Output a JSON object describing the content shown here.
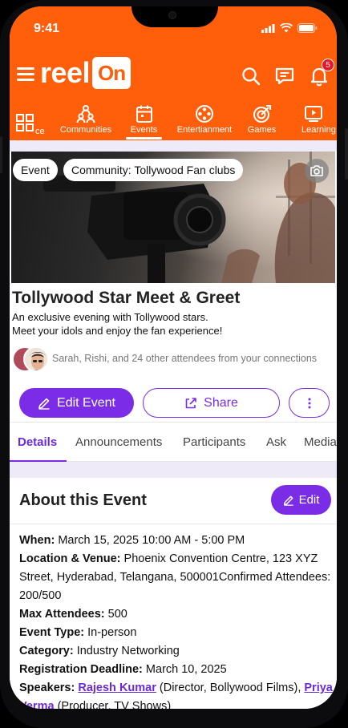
{
  "status_bar": {
    "time": "9:41"
  },
  "header": {
    "logo_text": "reel",
    "logo_box_text": "On",
    "notification_count": "5",
    "colors": {
      "brand": "#ff5f0b",
      "accent": "#7a2ce6"
    }
  },
  "nav": {
    "items": [
      {
        "label": "ce",
        "icon": "grid-icon"
      },
      {
        "label": "Communities",
        "icon": "people-icon"
      },
      {
        "label": "Events",
        "icon": "calendar-icon",
        "active": true
      },
      {
        "label": "Entertianment",
        "icon": "film-reel-icon"
      },
      {
        "label": "Games",
        "icon": "target-icon"
      },
      {
        "label": "Learning",
        "icon": "play-icon"
      }
    ]
  },
  "banner": {
    "chip_type": "Event",
    "chip_community": "Community: Tollywood Fan clubs"
  },
  "event": {
    "title": "Tollywood Star Meet & Greet",
    "description_line1": "An exclusive evening with Tollywood stars.",
    "description_line2": "Meet your idols and enjoy the fan experience!",
    "attendees_text": "Sarah, Rishi, and 24 other attendees from your connections"
  },
  "actions": {
    "edit_event": "Edit Event",
    "share": "Share"
  },
  "tabs": [
    "Details",
    "Announcements",
    "Participants",
    "Ask",
    "Media"
  ],
  "about": {
    "title": "About this Event",
    "edit_label": "Edit",
    "when_label": "When:",
    "when_value": "March 15, 2025 10:00 AM - 5:00 PM",
    "location_label": "Location & Venue:",
    "location_value": "Phoenix Convention Centre, 123 XYZ Street, Hyderabad, Telangana, 500001Confirmed Attendees: 200/500",
    "max_label": "Max Attendees:",
    "max_value": "500",
    "type_label": "Event Type:",
    "type_value": "In-person",
    "category_label": "Category:",
    "category_value": "Industry Networking",
    "deadline_label": "Registration Deadline:",
    "deadline_value": "March 10, 2025",
    "speakers_label": "Speakers:",
    "speaker1_name": "Rajesh Kumar",
    "speaker1_role": "(Director, Bollywood Films),",
    "speaker2_name": "Priya Verma",
    "speaker2_role": "(Producer, TV Shows)"
  }
}
